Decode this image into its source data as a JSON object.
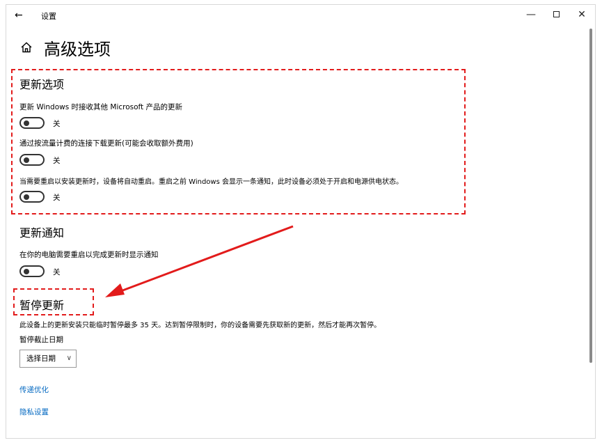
{
  "window": {
    "title": "设置",
    "back_icon": "←",
    "min_icon": "—",
    "close_icon": "✕"
  },
  "page": {
    "title": "高级选项"
  },
  "update_options": {
    "title": "更新选项",
    "items": [
      {
        "label": "更新 Windows 时接收其他 Microsoft 产品的更新",
        "state": "关"
      },
      {
        "label": "通过按流量计费的连接下载更新(可能会收取额外费用)",
        "state": "关"
      },
      {
        "label": "当需要重启以安装更新时，设备将自动重启。重启之前 Windows 会显示一条通知，此时设备必须处于开启和电源供电状态。",
        "state": "关"
      }
    ]
  },
  "update_notifications": {
    "title": "更新通知",
    "items": [
      {
        "label": "在你的电脑需要重启以完成更新时显示通知",
        "state": "关"
      }
    ]
  },
  "pause_updates": {
    "title": "暂停更新",
    "description": "此设备上的更新安装只能临时暂停最多 35 天。达到暂停限制时，你的设备需要先获取新的更新，然后才能再次暂停。",
    "date_label": "暂停截止日期",
    "date_select": "选择日期",
    "chevron": "∨"
  },
  "links": {
    "delivery_optimization": "传递优化",
    "privacy_settings": "隐私设置"
  },
  "colors": {
    "accent_link": "#0067c0",
    "annotation_red": "#e21b1b"
  }
}
